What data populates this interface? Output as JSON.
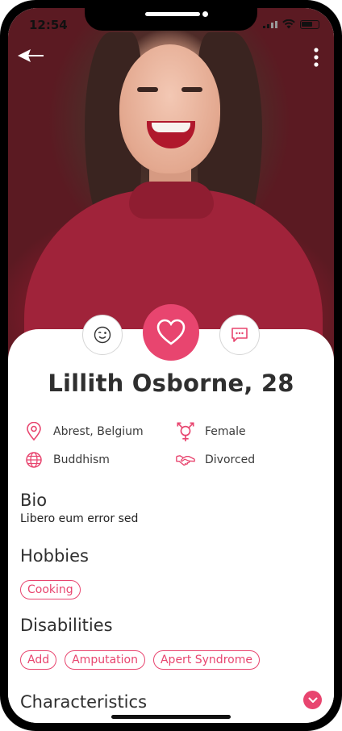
{
  "status_bar": {
    "time": "12:54"
  },
  "profile": {
    "name_age": "Lillith Osborne, 28",
    "photo_icon": "profile-photo"
  },
  "actions": {
    "wink_icon": "wink-face-icon",
    "like_icon": "heart-icon",
    "chat_icon": "chat-bubble-icon"
  },
  "info": {
    "location": "Abrest, Belgium",
    "gender": "Female",
    "religion": "Buddhism",
    "relationship_status": "Divorced"
  },
  "bio": {
    "title": "Bio",
    "text": "Libero eum error sed"
  },
  "hobbies": {
    "title": "Hobbies",
    "items": [
      "Cooking"
    ]
  },
  "disabilities": {
    "title": "Disabilities",
    "items": [
      "Add",
      "Amputation",
      "Apert Syndrome"
    ]
  },
  "characteristics": {
    "title": "Characteristics"
  },
  "colors": {
    "accent": "#e8456f",
    "text_dark": "#2f2f2f"
  }
}
